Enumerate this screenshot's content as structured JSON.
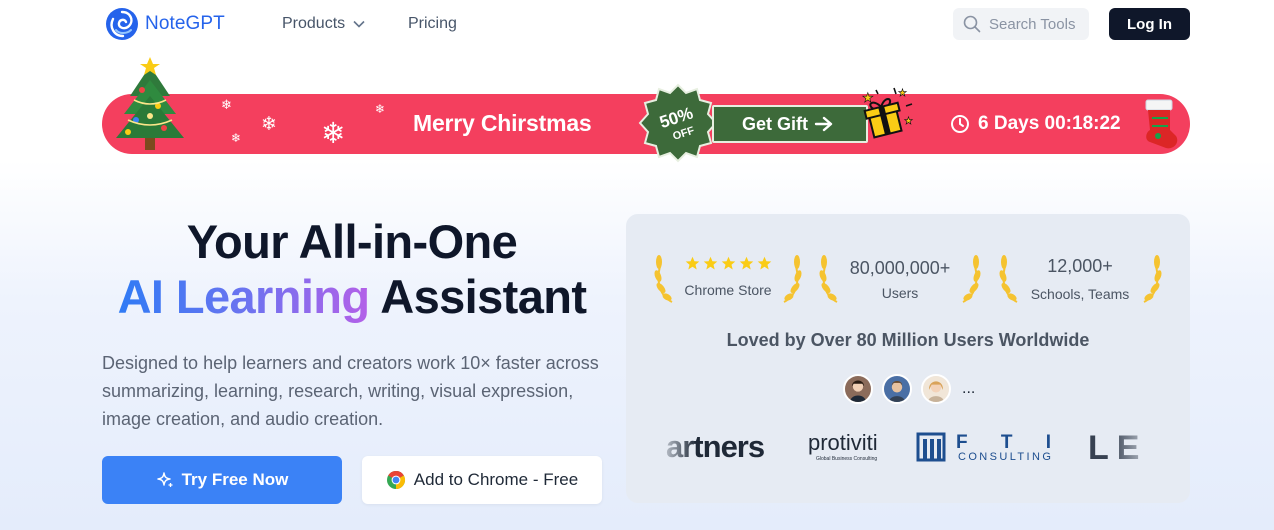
{
  "nav": {
    "logo_text": "NoteGPT",
    "products": "Products",
    "pricing": "Pricing",
    "search_placeholder": "Search Tools",
    "login": "Log In"
  },
  "banner": {
    "title": "Merry Chirstmas",
    "badge_percent": "50%",
    "badge_off": "OFF",
    "gift_label": "Get Gift",
    "countdown": "6 Days 00:18:22",
    "colors": {
      "background": "#f43f5e",
      "gift_button": "#3d6a3a"
    }
  },
  "hero": {
    "line1": "Your All-in-One",
    "line2_gradient": "AI Learning",
    "line2_rest": "Assistant",
    "description": "Designed to help learners and creators work 10× faster across summarizing, learning, research, writing, visual expression, image creation, and audio creation.",
    "try_button": "Try Free Now",
    "chrome_button": "Add to Chrome - Free"
  },
  "stats": {
    "items": [
      {
        "value": "★★★★★",
        "label": "Chrome Store",
        "rating": 5
      },
      {
        "value": "80,000,000+",
        "label": "Users"
      },
      {
        "value": "12,000+",
        "label": "Schools, Teams"
      }
    ],
    "loved": "Loved by Over 80 Million Users Worldwide",
    "more": "...",
    "partner_logos": [
      "artners",
      "protiviti",
      "Global Business Consulting",
      "F T I",
      "CONSULTING",
      "LE"
    ]
  },
  "colors": {
    "brand": "#2563eb",
    "primary_button": "#3b82f6",
    "dark_button": "#0f172a"
  }
}
